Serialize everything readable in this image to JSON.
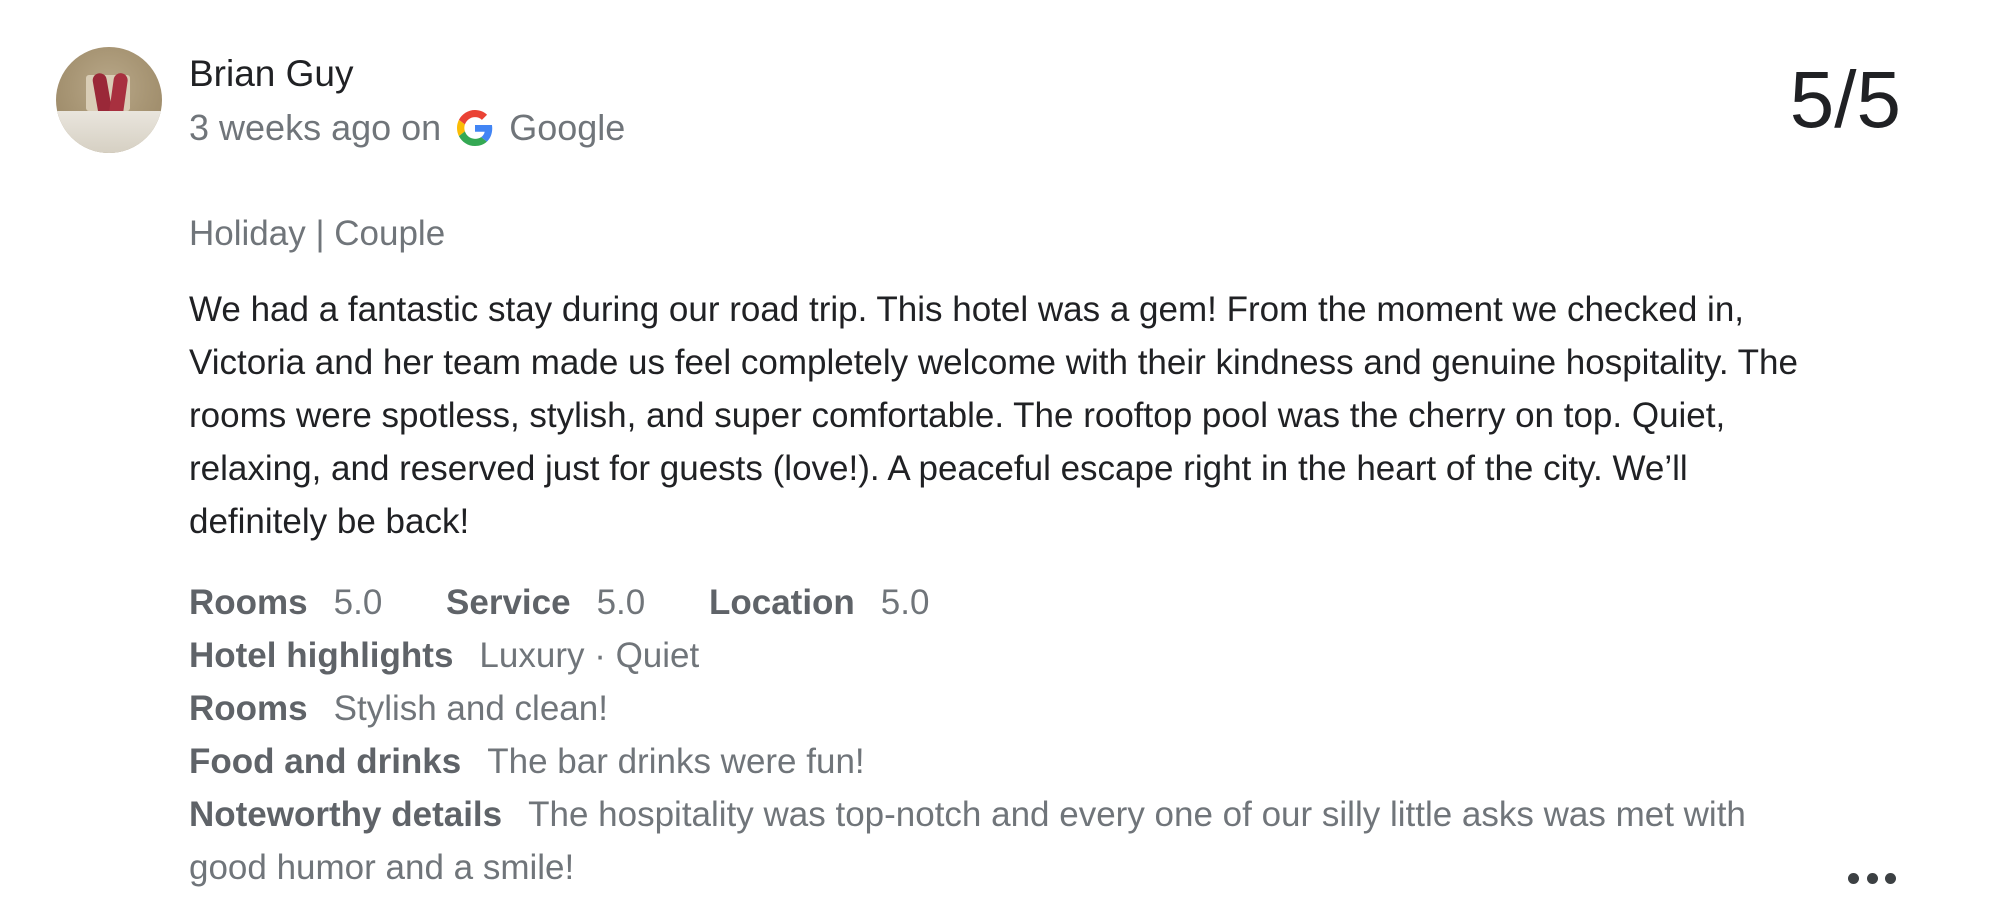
{
  "review": {
    "author": "Brian Guy",
    "time": "3 weeks ago on",
    "source": "Google",
    "score": "5/5",
    "trip_type": "Holiday | Couple",
    "text": "We had a fantastic stay during our road trip. This hotel was a gem! From the moment we checked in, Victoria and her team made us feel completely welcome with their kindness and genuine hospitality. The rooms were spotless, stylish, and super comfortable. The rooftop pool was the cherry on top. Quiet, relaxing, and reserved just for guests (love!). A peaceful escape right in the heart of the city. We’ll definitely be back!",
    "ratings": [
      {
        "label": "Rooms",
        "value": "5.0"
      },
      {
        "label": "Service",
        "value": "5.0"
      },
      {
        "label": "Location",
        "value": "5.0"
      }
    ],
    "attributes": [
      {
        "label": "Hotel highlights",
        "value": "Luxury · Quiet"
      },
      {
        "label": "Rooms",
        "value": "Stylish and clean!"
      },
      {
        "label": "Food and drinks",
        "value": "The bar drinks were fun!"
      },
      {
        "label": "Noteworthy details",
        "value": "The hospitality was top-notch and every one of our silly little asks was met with good humor and a smile!"
      }
    ]
  },
  "icons": {
    "avatar": "user-photo-avatar",
    "source": "google-g-icon",
    "more": "more-options-icon"
  },
  "colors": {
    "primary_text": "#202124",
    "secondary_text": "#70757a",
    "label_text": "#5f6368",
    "google_blue": "#4285F4",
    "google_red": "#EA4335",
    "google_yellow": "#FBBC05",
    "google_green": "#34A853"
  }
}
